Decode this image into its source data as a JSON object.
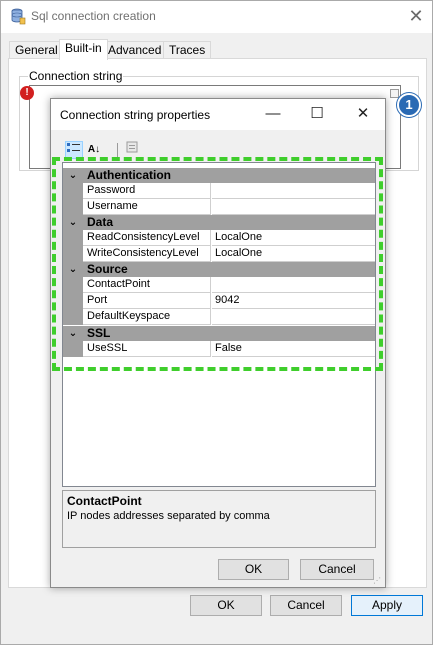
{
  "window": {
    "title": "Sql connection creation",
    "tabs": [
      {
        "label": "General",
        "active": false
      },
      {
        "label": "Built-in",
        "active": true
      },
      {
        "label": "Advanced",
        "active": false
      },
      {
        "label": "Traces",
        "active": false
      }
    ],
    "connection_group_label": "Connection string",
    "buttons": {
      "ok": "OK",
      "cancel": "Cancel",
      "apply": "Apply"
    },
    "callout_number": "1"
  },
  "dialog": {
    "title": "Connection string properties",
    "categories": [
      {
        "name": "Authentication",
        "properties": [
          {
            "name": "Password",
            "value": ""
          },
          {
            "name": "Username",
            "value": ""
          }
        ]
      },
      {
        "name": "Data",
        "properties": [
          {
            "name": "ReadConsistencyLevel",
            "value": "LocalOne"
          },
          {
            "name": "WriteConsistencyLevel",
            "value": "LocalOne"
          }
        ]
      },
      {
        "name": "Source",
        "properties": [
          {
            "name": "ContactPoint",
            "value": ""
          },
          {
            "name": "Port",
            "value": "9042"
          },
          {
            "name": "DefaultKeyspace",
            "value": ""
          }
        ]
      },
      {
        "name": "SSL",
        "properties": [
          {
            "name": "UseSSL",
            "value": "False"
          }
        ]
      }
    ],
    "description": {
      "title": "ContactPoint",
      "text": "IP nodes addresses separated by comma"
    },
    "buttons": {
      "ok": "OK",
      "cancel": "Cancel"
    }
  },
  "colors": {
    "highlight": "#3fce2c",
    "callout": "#2a6ab4",
    "error": "#d21f1f",
    "category_band": "#a0a0a0"
  }
}
